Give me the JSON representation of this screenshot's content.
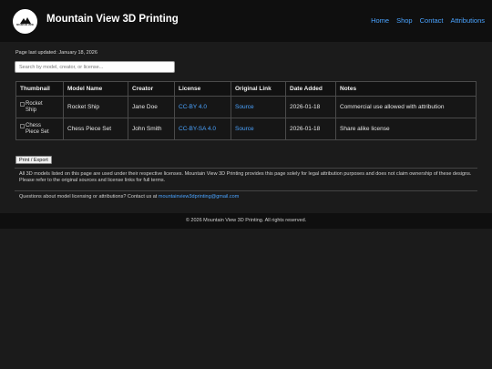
{
  "header": {
    "logo_text": "MOUNTAIN VIEW",
    "title": "Mountain View 3D Printing",
    "nav": [
      "Home",
      "Shop",
      "Contact",
      "Attributions"
    ]
  },
  "main": {
    "updated": "Page last updated: January 18, 2026",
    "search_placeholder": "Search by model, creator, or license...",
    "table": {
      "headers": [
        "Thumbnail",
        "Model Name",
        "Creator",
        "License",
        "Original Link",
        "Date Added",
        "Notes"
      ],
      "rows": [
        {
          "thumb_line1": "Rocket",
          "thumb_line2": "Ship",
          "model": "Rocket Ship",
          "creator": "Jane Doe",
          "license": "CC-BY 4.0",
          "link": "Source",
          "date": "2026-01-18",
          "notes": "Commercial use allowed with attribution"
        },
        {
          "thumb_line1": "Chess",
          "thumb_line2": "Piece Set",
          "model": "Chess Piece Set",
          "creator": "John Smith",
          "license": "CC-BY-SA 4.0",
          "link": "Source",
          "date": "2026-01-18",
          "notes": "Share alike license"
        }
      ]
    },
    "print_label": "Print / Export",
    "disclaimer": "All 3D models listed on this page are used under their respective licenses. Mountain View 3D Printing provides this page solely for legal attribution purposes and does not claim ownership of these designs. Please refer to the original sources and license links for full terms.",
    "contact_prefix": "Questions about model licensing or attributions? Contact us at ",
    "contact_email": "mountainview3dprinting@gmail.com"
  },
  "footer": {
    "text": "© 2026 Mountain View 3D Printing. All rights reserved."
  },
  "colors": {
    "background": "#1b1b1b",
    "header": "#0f0f0f",
    "link": "#4aa3ff"
  }
}
